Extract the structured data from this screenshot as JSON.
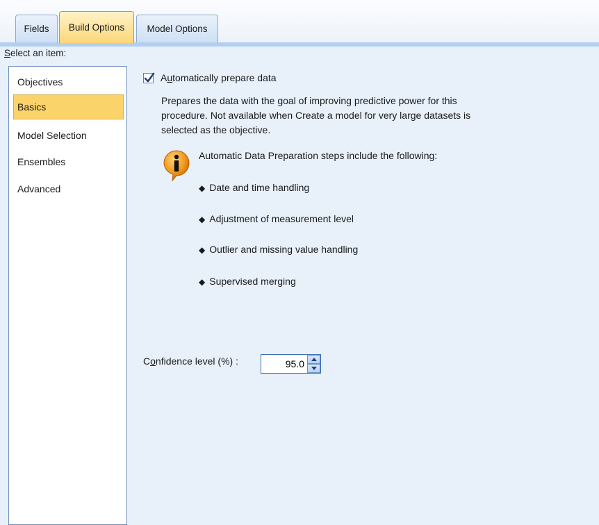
{
  "tabs": [
    {
      "label": "Fields",
      "active": false
    },
    {
      "label": "Build Options",
      "active": true
    },
    {
      "label": "Model Options",
      "active": false
    }
  ],
  "select_item_label": {
    "mnemonic": "S",
    "rest": "elect an item:"
  },
  "items": [
    {
      "label": "Objectives",
      "selected": false
    },
    {
      "label": "Basics",
      "selected": true
    },
    {
      "label": "Model Selection",
      "selected": false
    },
    {
      "label": "Ensembles",
      "selected": false
    },
    {
      "label": "Advanced",
      "selected": false
    }
  ],
  "auto_prepare": {
    "checked": true,
    "label_before": "A",
    "label_mnemonic": "u",
    "label_after": "tomatically prepare data",
    "description": "Prepares the data with the goal of improving predictive power for this procedure.  Not available when Create a model for very large datasets is selected as the objective."
  },
  "info_icon": "info-icon",
  "steps_intro": "Automatic Data Preparation steps include the following:",
  "steps": [
    "Date and time handling",
    "Adjustment of measurement level",
    "Outlier and missing value handling",
    "Supervised merging"
  ],
  "bullet_glyph": "◆",
  "confidence": {
    "label_before": "C",
    "label_mnemonic": "o",
    "label_after": "nfidence level (%) :",
    "value": "95.0"
  },
  "colors": {
    "selected_accent": "#fbd36b",
    "background": "#e8f0f9",
    "tab_band": "#b3cff0"
  }
}
